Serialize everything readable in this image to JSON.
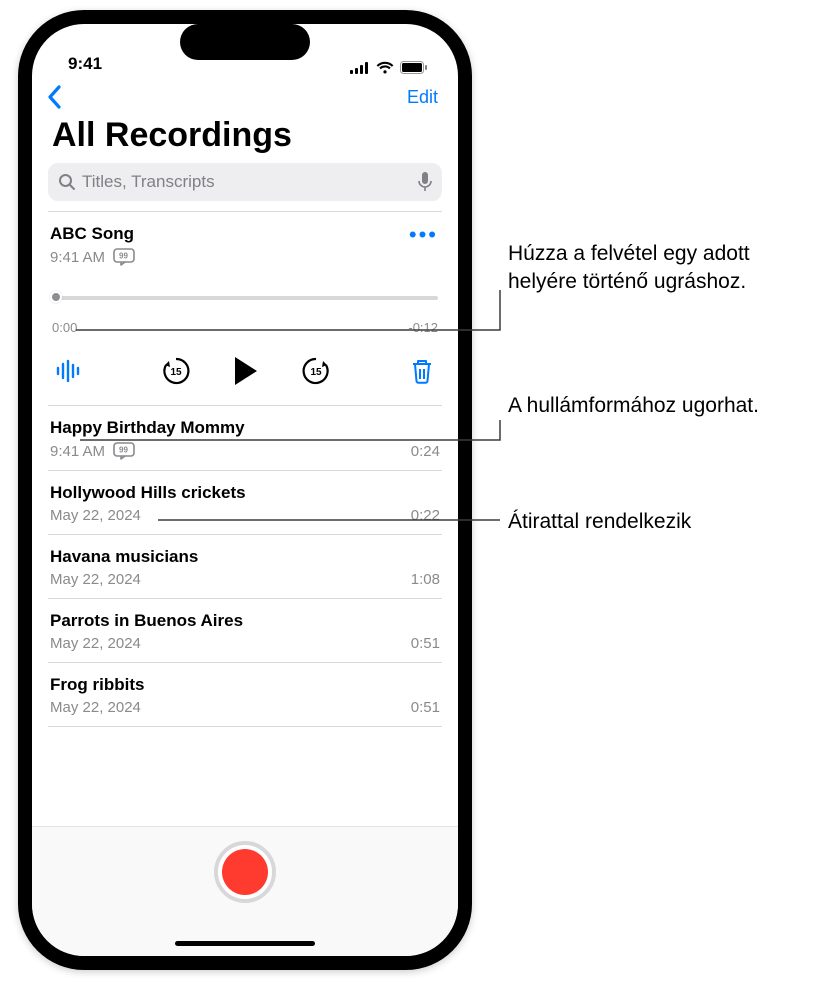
{
  "status": {
    "time": "9:41"
  },
  "nav": {
    "edit": "Edit"
  },
  "title": "All Recordings",
  "search": {
    "placeholder": "Titles, Transcripts"
  },
  "expanded": {
    "title": "ABC Song",
    "subtitle": "9:41 AM",
    "time_start": "0:00",
    "time_end": "-0:12"
  },
  "rows": [
    {
      "title": "Happy Birthday Mommy",
      "subtitle": "9:41 AM",
      "duration": "0:24",
      "has_transcript": true
    },
    {
      "title": "Hollywood Hills crickets",
      "subtitle": "May 22, 2024",
      "duration": "0:22",
      "has_transcript": false
    },
    {
      "title": "Havana musicians",
      "subtitle": "May 22, 2024",
      "duration": "1:08",
      "has_transcript": false
    },
    {
      "title": "Parrots in Buenos Aires",
      "subtitle": "May 22, 2024",
      "duration": "0:51",
      "has_transcript": false
    },
    {
      "title": "Frog ribbits",
      "subtitle": "May 22, 2024",
      "duration": "0:51",
      "has_transcript": false
    }
  ],
  "callouts": {
    "c1": "Húzza a felvétel egy adott helyére történő ugráshoz.",
    "c2": "A hullámformához ugorhat.",
    "c3": "Átirattal rendelkezik"
  }
}
